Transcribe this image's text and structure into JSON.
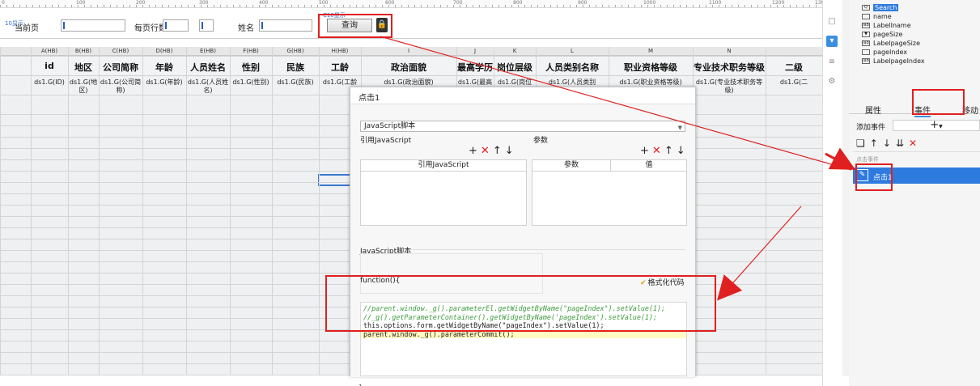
{
  "ruler": {
    "ticks": [
      "0",
      "100",
      "200",
      "300",
      "400",
      "500",
      "600",
      "700",
      "800",
      "900",
      "1000",
      "1100",
      "1200",
      "130"
    ]
  },
  "param_panel": {
    "current_page_label": "当前页",
    "per_page_label": "每页行数",
    "name_label": "姓名",
    "query_button": "查询",
    "ghost_left": "10显示",
    "ghost_right": "C10显示"
  },
  "grid": {
    "column_headers": [
      "A(HB)",
      "B(HB)",
      "C(HB)",
      "D(HB)",
      "E(HB)",
      "F(HB)",
      "G(HB)",
      "H(HB)",
      "I",
      "J",
      "K",
      "L",
      "M",
      "N"
    ],
    "header_row": [
      "id",
      "地区",
      "公司简称",
      "年龄",
      "人员姓名",
      "性别",
      "民族",
      "工龄",
      "政治面貌",
      "最高学历",
      "岗位层级",
      "人员类别名称",
      "职业资格等级",
      "专业技术职务等级",
      "二级"
    ],
    "data_row": [
      "ds1.G(ID)",
      "ds1.G(地区)",
      "ds1.G(公司简称)",
      "ds1.G(年龄)",
      "ds1.G(人员姓名)",
      "ds1.G(性别)",
      "ds1.G(民族)",
      "ds1.G(工龄",
      "ds1.G(政治面貌)",
      "ds1.G(最高",
      "ds1.G(岗位",
      "ds1.G(人员类别",
      "ds1.G(职业资格等级)",
      "ds1.G(专业技术职务等级)",
      "ds1.G(二"
    ]
  },
  "dialog": {
    "title": "点击1",
    "type_select": "JavaScript脚本",
    "ref_js_label": "引用JavaScript",
    "params_label": "参数",
    "ref_js_col": "引用JavaScript",
    "param_col": "参数",
    "value_col": "值",
    "js_script_label": "JavaScript脚本",
    "function_label": "function(){",
    "format_label": "格式化代码",
    "closing_brace": "}",
    "code_lines": [
      "//parent.window._g().parameterEl.getWidgetByName(\"pageIndex\").setValue(1);",
      "//_g().getParameterContainer().getWidgetByName('pageIndex').setValue(1);",
      "this.options.form.getWidgetByName(\"pageIndex\").setValue(1);",
      "parent.window._g().parameterCommit();"
    ]
  },
  "right_panel": {
    "widgets": [
      "Search",
      "name",
      "LabelIname",
      "pageSize",
      "LabelpageSize",
      "pageIndex",
      "LabelpageIndex"
    ],
    "tabs": [
      "属性",
      "事件",
      "移动"
    ],
    "add_event_label": "添加事件",
    "event_group": "点击事件",
    "event_item": "点击1"
  },
  "colors": {
    "annotation_red": "#e02020",
    "selection_blue": "#2e7be0"
  }
}
